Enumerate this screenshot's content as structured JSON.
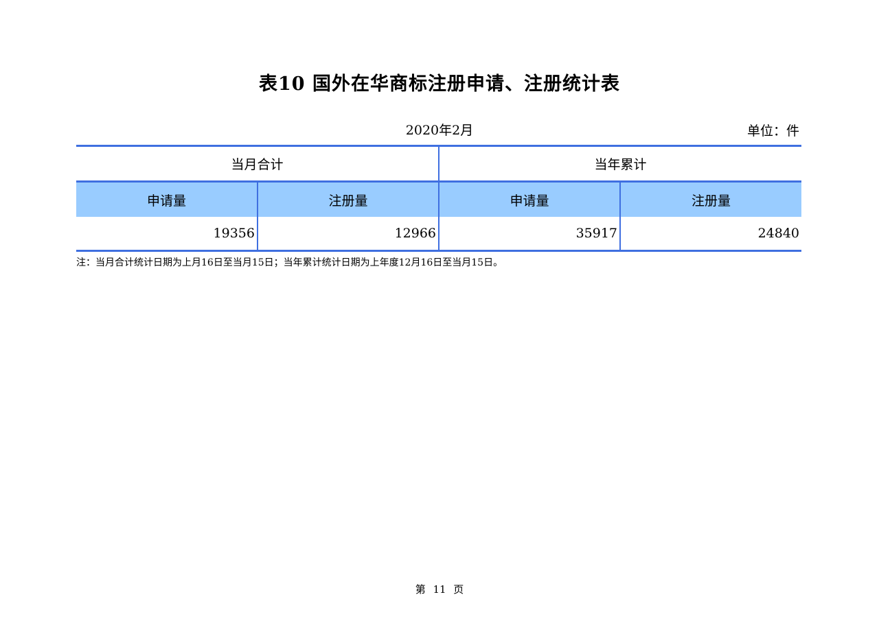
{
  "title": "表10  国外在华商标注册申请、注册统计表",
  "period": "2020年2月",
  "unit": "单位：件",
  "table": {
    "groups": [
      "当月合计",
      "当年累计"
    ],
    "columns": [
      "申请量",
      "注册量",
      "申请量",
      "注册量"
    ],
    "values": [
      "19356",
      "12966",
      "35917",
      "24840"
    ]
  },
  "note": "注：当月合计统计日期为上月16日至当月15日；当年累计统计日期为上年度12月16日至当月15日。",
  "footer": {
    "page_label": "第 11 页"
  },
  "colors": {
    "border": "#3f6fe0",
    "header_fill": "#99ccff"
  }
}
